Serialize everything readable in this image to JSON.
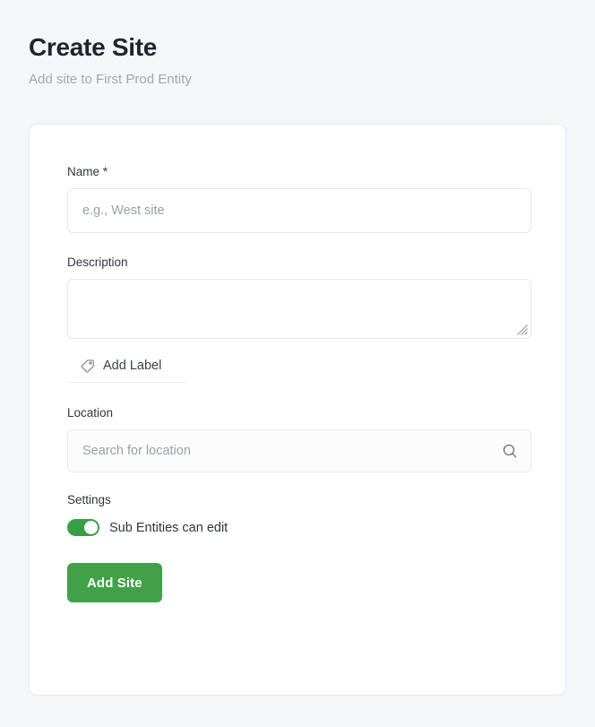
{
  "header": {
    "title": "Create Site",
    "subtitle": "Add site to First Prod Entity"
  },
  "form": {
    "name": {
      "label": "Name *",
      "value": "",
      "placeholder": "e.g., West site"
    },
    "description": {
      "label": "Description",
      "value": "",
      "placeholder": ""
    },
    "add_label": {
      "text": "Add Label",
      "icon": "tag-icon"
    },
    "location": {
      "label": "Location",
      "value": "",
      "placeholder": "Search for location",
      "icon": "search-icon"
    },
    "settings": {
      "label": "Settings",
      "toggle": {
        "text": "Sub Entities can edit",
        "state": "on"
      }
    },
    "submit": {
      "label": "Add Site"
    }
  },
  "colors": {
    "page_background": "#f4f6f8",
    "card_background": "#ffffff",
    "accent_green": "#41a148",
    "toggle_green": "#36a045",
    "title_text": "#1f2430",
    "subtitle_text": "#a3a7af",
    "placeholder_text": "#9aa0a8",
    "border": "#e6e9ed"
  }
}
